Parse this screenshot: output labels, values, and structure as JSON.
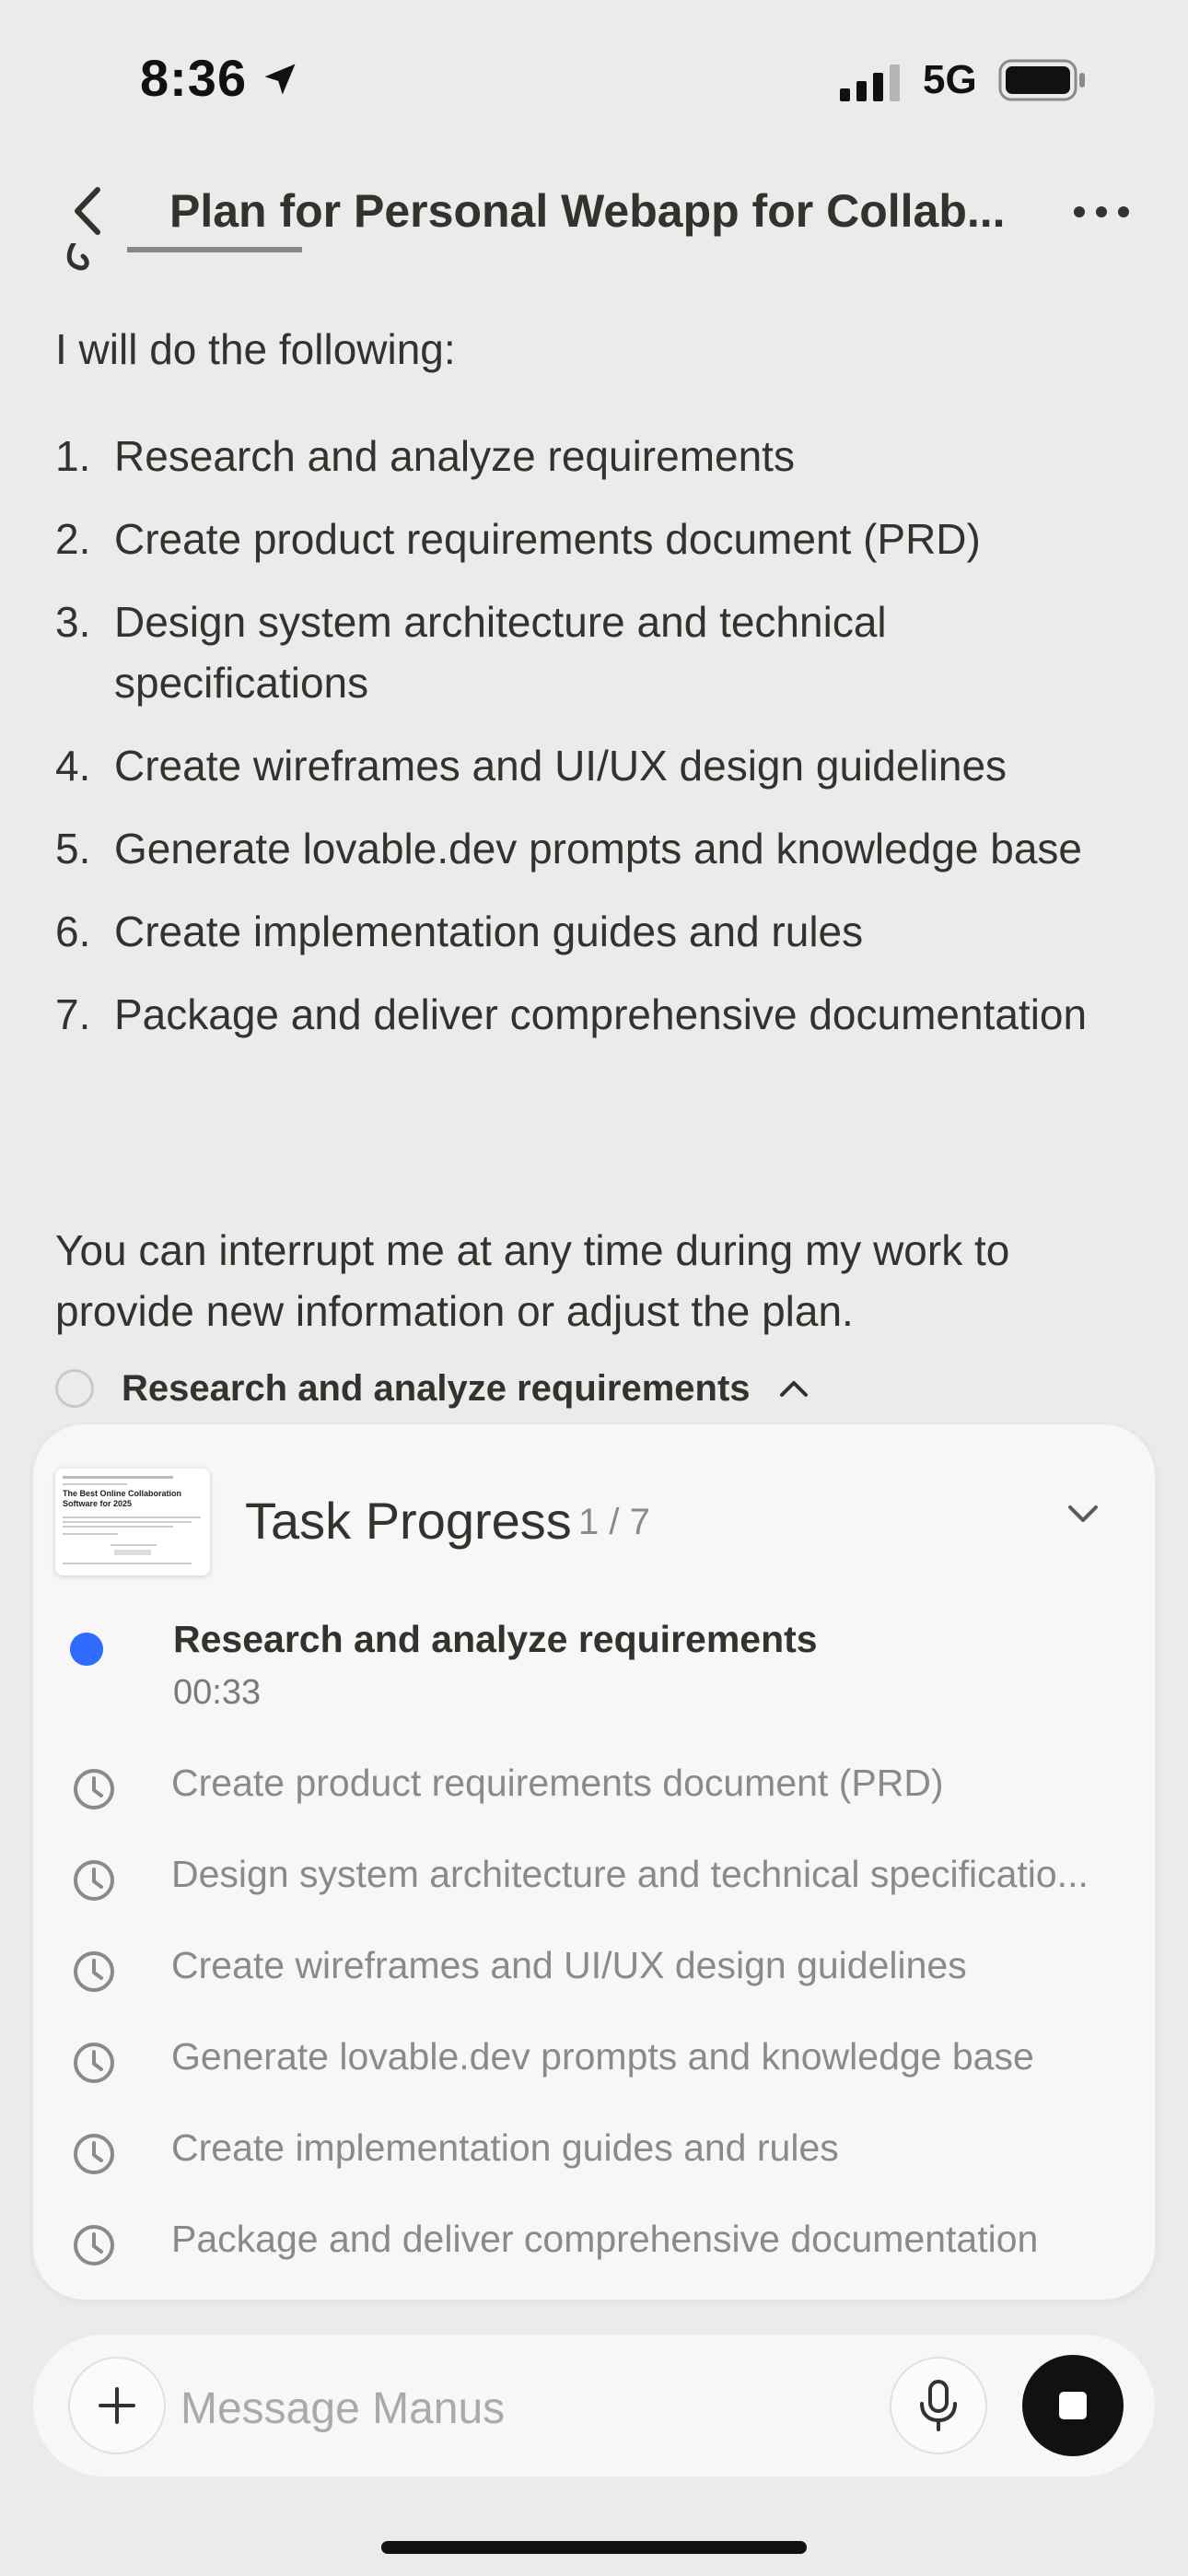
{
  "status_bar": {
    "time": "8:36",
    "network": "5G",
    "icons": [
      "location-arrow-icon",
      "signal-icon",
      "battery-icon"
    ]
  },
  "header": {
    "title": "Plan for Personal Webapp for Collab...",
    "back_icon": "chevron-left-icon",
    "more_icon": "ellipsis-icon"
  },
  "message": {
    "intro": "I will do the following:",
    "plan": [
      {
        "num": "1.",
        "text": "Research and analyze requirements"
      },
      {
        "num": "2.",
        "text": "Create product requirements document (PRD)"
      },
      {
        "num": "3.",
        "text": "Design system architecture and technical specifications"
      },
      {
        "num": "4.",
        "text": "Create wireframes and UI/UX design guidelines"
      },
      {
        "num": "5.",
        "text": "Generate lovable.dev prompts and knowledge base"
      },
      {
        "num": "6.",
        "text": "Create implementation guides and rules"
      },
      {
        "num": "7.",
        "text": "Package and deliver comprehensive documentation"
      }
    ],
    "note": "You can interrupt me at any time during my work to provide new information or adjust the plan."
  },
  "current_step": {
    "label": "Research and analyze requirements"
  },
  "task_progress": {
    "title": "Task Progress",
    "count": "1 / 7",
    "thumbnail": {
      "heading": "The Best Online Collaboration Software for 2025"
    },
    "active": {
      "label": "Research and analyze requirements",
      "elapsed": "00:33"
    },
    "pending": [
      "Create product requirements document (PRD)",
      "Design system architecture and technical specificatio...",
      "Create wireframes and UI/UX design guidelines",
      "Generate lovable.dev prompts and knowledge base",
      "Create implementation guides and rules",
      "Package and deliver comprehensive documentation"
    ]
  },
  "composer": {
    "placeholder": "Message Manus"
  },
  "colors": {
    "background": "#ebebeb",
    "card": "#f7f7f8",
    "active_blue": "#2f6bff",
    "text": "#34322d",
    "muted": "#8a8a8a"
  }
}
